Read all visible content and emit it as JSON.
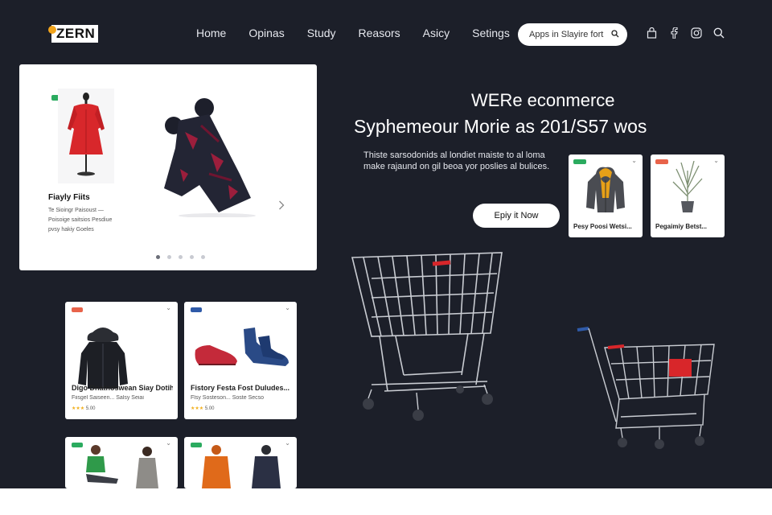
{
  "brand": {
    "name": "ZERN",
    "accent": "#f2a41b"
  },
  "nav": {
    "items": [
      "Home",
      "Opinas",
      "Study",
      "Reasors",
      "Asicy",
      "Setings"
    ]
  },
  "search": {
    "placeholder": "Apps in Slayire fort"
  },
  "header_icons": [
    "bag-icon",
    "facebook-icon",
    "instagram-icon",
    "search-icon"
  ],
  "hero_card": {
    "title": "Fiayly Fiits",
    "description": "Te Sioingr Paisoust — Poisoige saitsios Pesdiue pvsy hakiy Goeles",
    "carousel_dots": 5,
    "active_dot": 1
  },
  "hero": {
    "heading": "WERe econmerce",
    "subheading": "Syphemeour Morie as 201/S57 wos",
    "body": "Thiste sarsodonids al londiet maiste to al loma make rajaund on gil beoa yor poslies al bulices.",
    "cta_label": "Epiy it Now"
  },
  "mini_products": [
    {
      "title": "Pesy Poosi Wetsi...",
      "badge_color": "#2bab5f"
    },
    {
      "title": "Pegaimiy Betst...",
      "badge_color": "#e8634a"
    }
  ],
  "products": [
    {
      "title": "Digo Dnatnoswean Siay Dotih...",
      "subtitle": "Fiisgel Saiseen... Salsy Seiai",
      "rating": "5.00",
      "stars": "★★★",
      "badge_color": "#e8634a"
    },
    {
      "title": "Fistory Festa Fost Duludes...",
      "subtitle": "Flsy Sosteson... Soste Secso",
      "rating": "5.00",
      "stars": "★★★",
      "badge_color": "#2f5aa8"
    },
    {
      "title": "",
      "subtitle": "",
      "rating": "",
      "stars": "",
      "badge_color": "#2bab5f"
    },
    {
      "title": "",
      "subtitle": "",
      "rating": "",
      "stars": "",
      "badge_color": "#2bab5f"
    }
  ],
  "colors": {
    "background": "#1c1f29",
    "card": "#ffffff",
    "cart_red": "#d8262a"
  }
}
